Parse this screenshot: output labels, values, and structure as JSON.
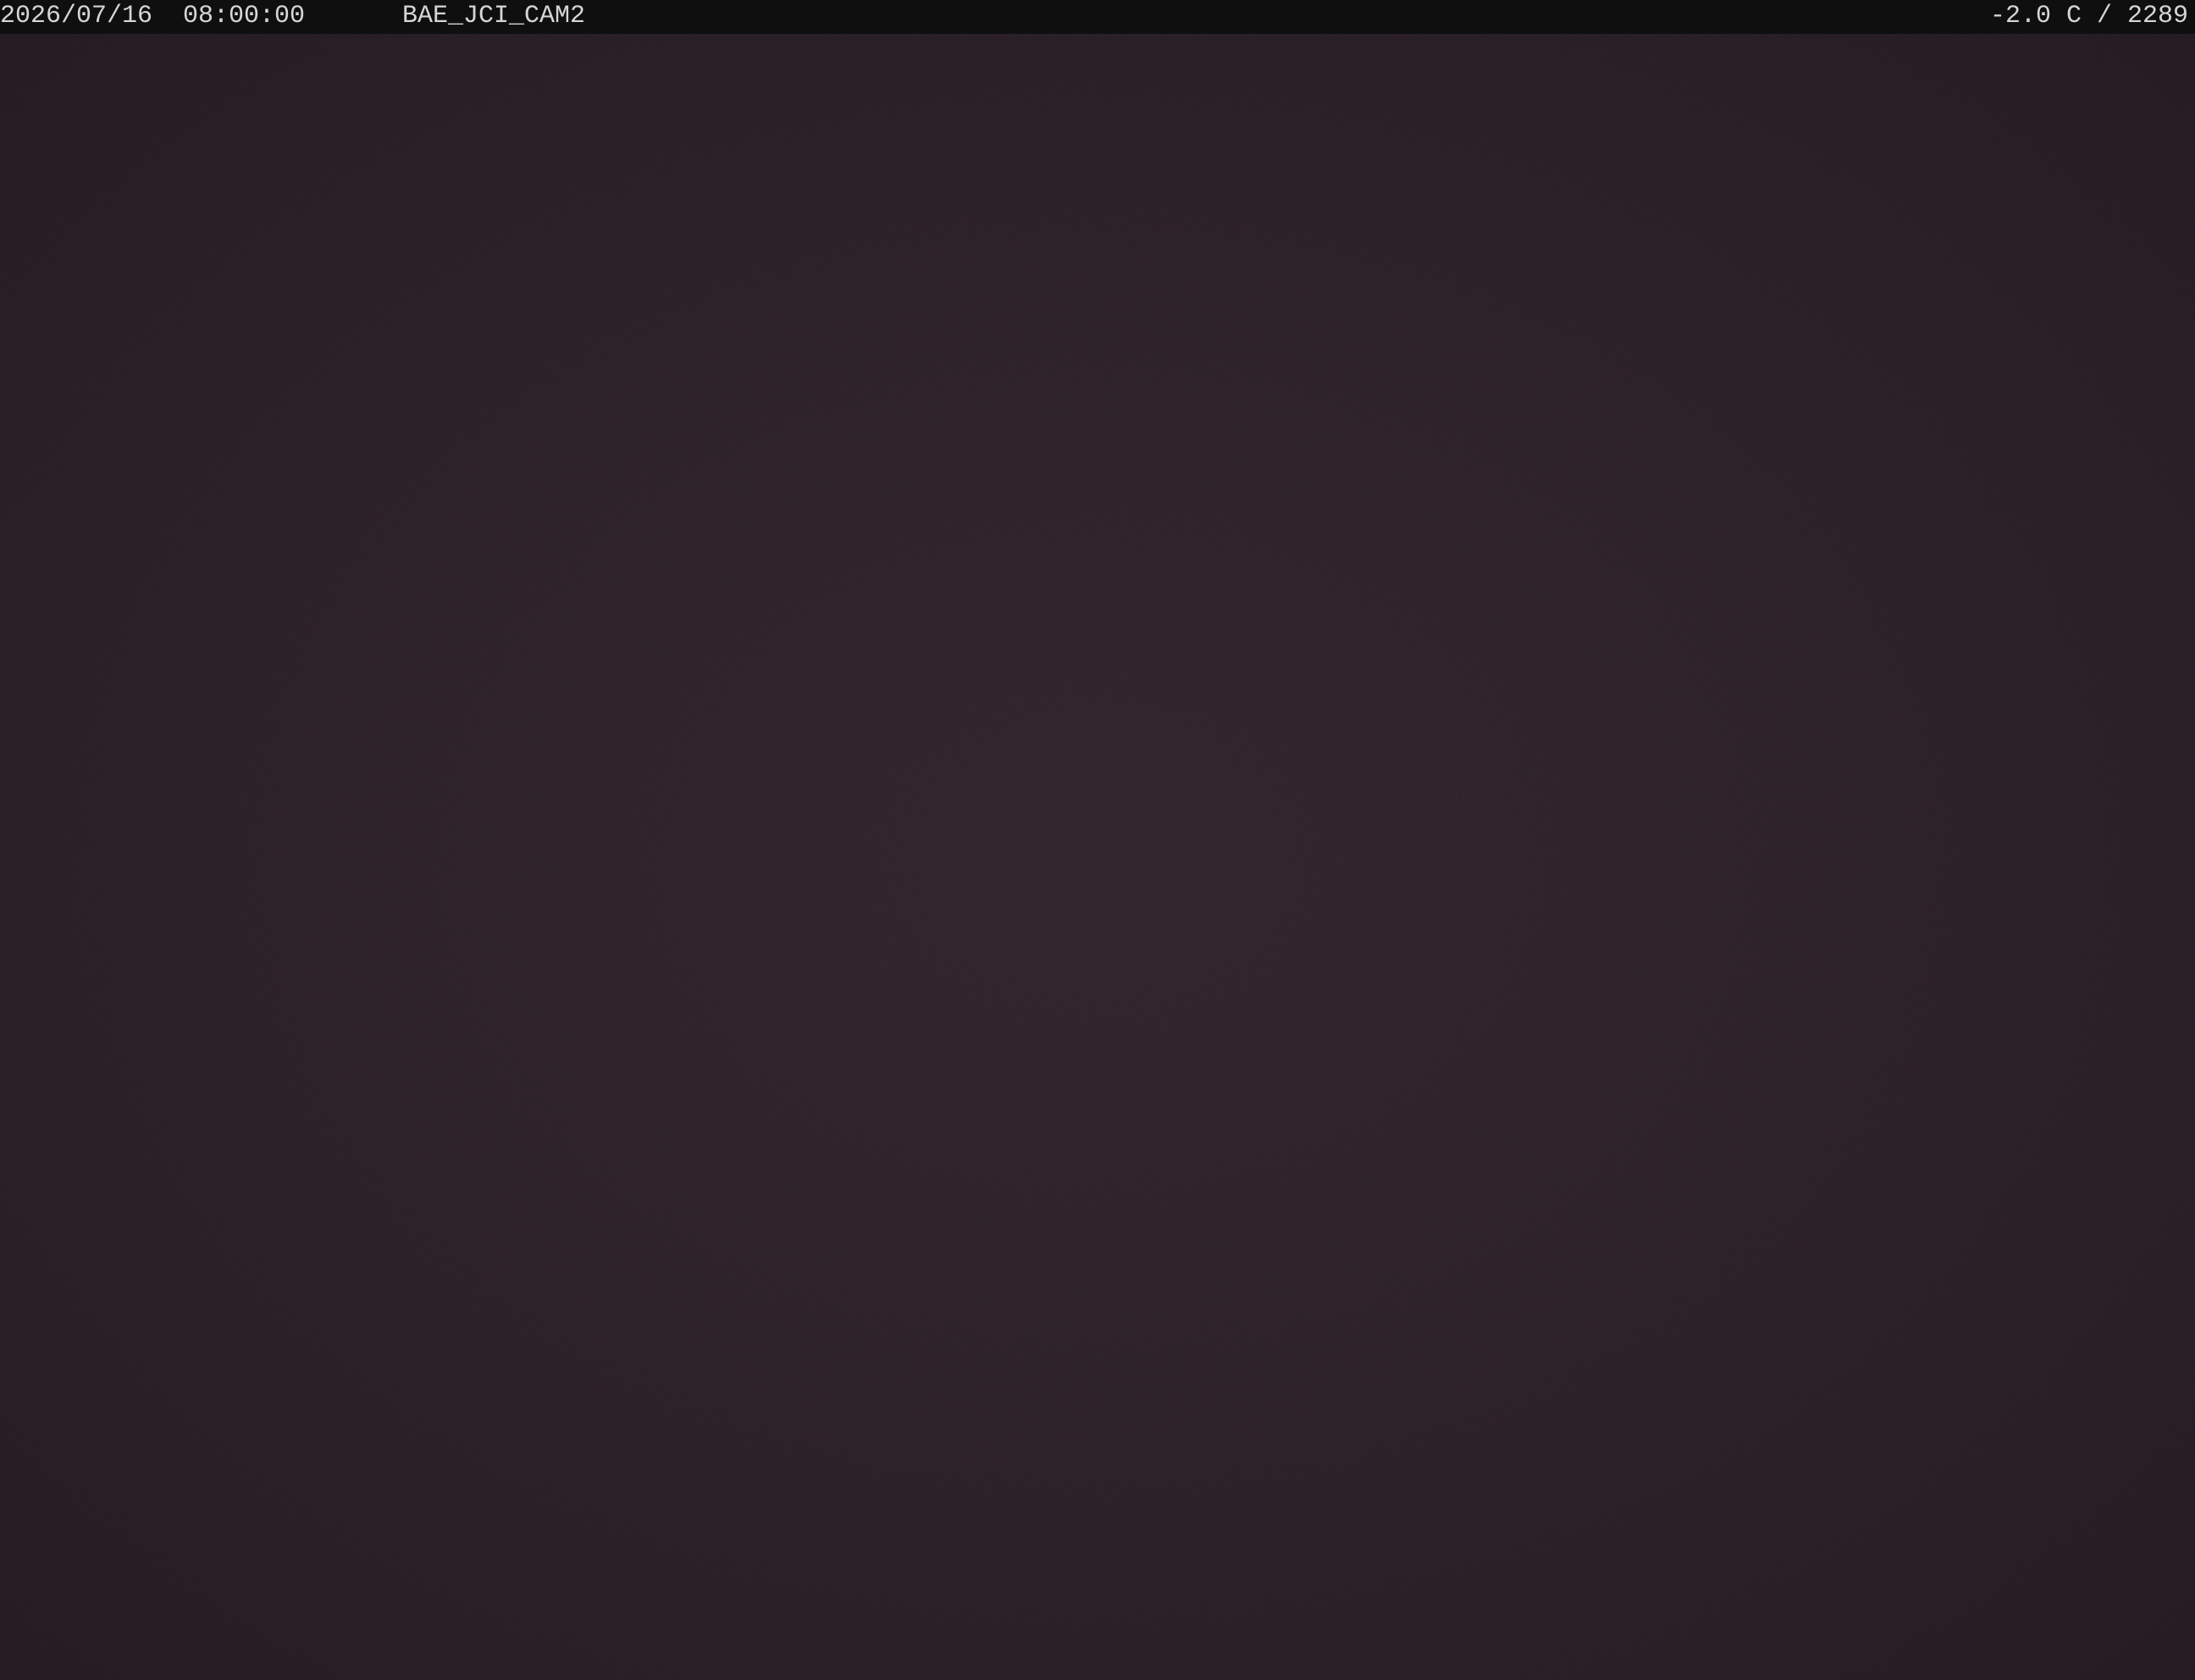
{
  "overlay": {
    "timestamp": "2026/07/16  08:00:00",
    "camera_id": "BAE_JCI_CAM2",
    "temperature_elevation": "-2.0 C / 2289"
  },
  "scene": {
    "description_colors": {
      "base": "#1c1719",
      "noise_red": "#7a1f22",
      "noise_blue": "#2a2248"
    }
  }
}
